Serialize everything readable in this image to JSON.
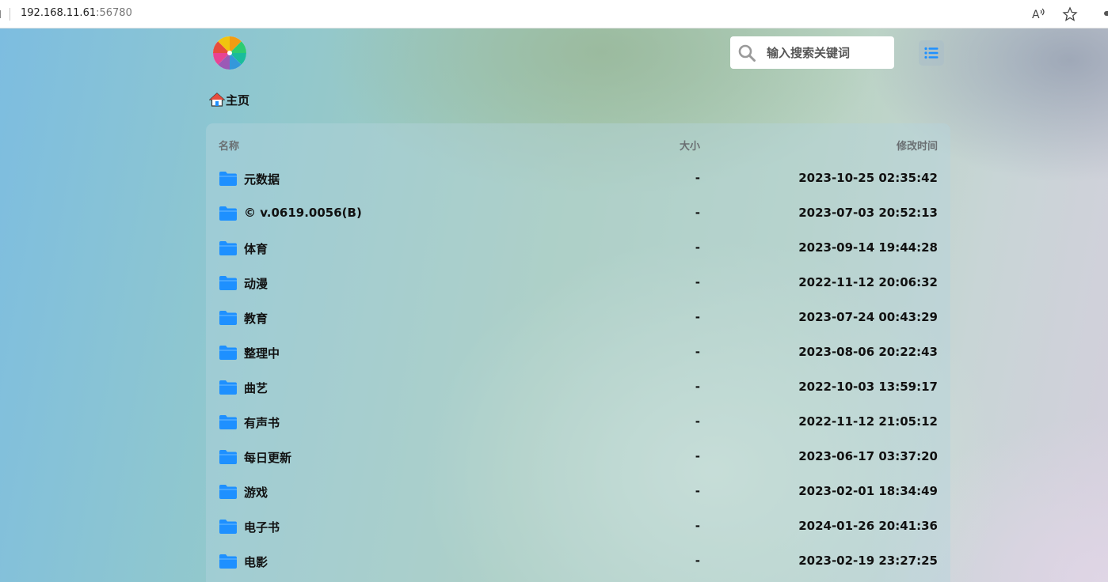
{
  "browser": {
    "url_host": "192.168.11.61",
    "url_port": ":56780"
  },
  "header": {
    "search_placeholder": "输入搜索关键词"
  },
  "breadcrumb": {
    "label": "主页"
  },
  "table": {
    "columns": {
      "name": "名称",
      "size": "大小",
      "modified": "修改时间"
    },
    "rows": [
      {
        "name": "元数据",
        "size": "-",
        "modified": "2023-10-25 02:35:42"
      },
      {
        "name": "© v.0619.0056(B)",
        "size": "-",
        "modified": "2023-07-03 20:52:13"
      },
      {
        "name": "体育",
        "size": "-",
        "modified": "2023-09-14 19:44:28"
      },
      {
        "name": "动漫",
        "size": "-",
        "modified": "2022-11-12 20:06:32"
      },
      {
        "name": "教育",
        "size": "-",
        "modified": "2023-07-24 00:43:29"
      },
      {
        "name": "整理中",
        "size": "-",
        "modified": "2023-08-06 20:22:43"
      },
      {
        "name": "曲艺",
        "size": "-",
        "modified": "2022-10-03 13:59:17"
      },
      {
        "name": "有声书",
        "size": "-",
        "modified": "2022-11-12 21:05:12"
      },
      {
        "name": "每日更新",
        "size": "-",
        "modified": "2023-06-17 03:37:20"
      },
      {
        "name": "游戏",
        "size": "-",
        "modified": "2023-02-01 18:34:49"
      },
      {
        "name": "电子书",
        "size": "-",
        "modified": "2024-01-26 20:41:36"
      },
      {
        "name": "电影",
        "size": "-",
        "modified": "2023-02-19 23:27:25"
      }
    ]
  },
  "colors": {
    "folder": "#1e90ff",
    "accent": "#1e90ff"
  },
  "icons": {
    "read_aloud": "read-aloud-icon",
    "favorite": "star-icon",
    "search": "search-icon",
    "menu": "list-icon",
    "home": "home-icon",
    "folder": "folder-icon"
  }
}
